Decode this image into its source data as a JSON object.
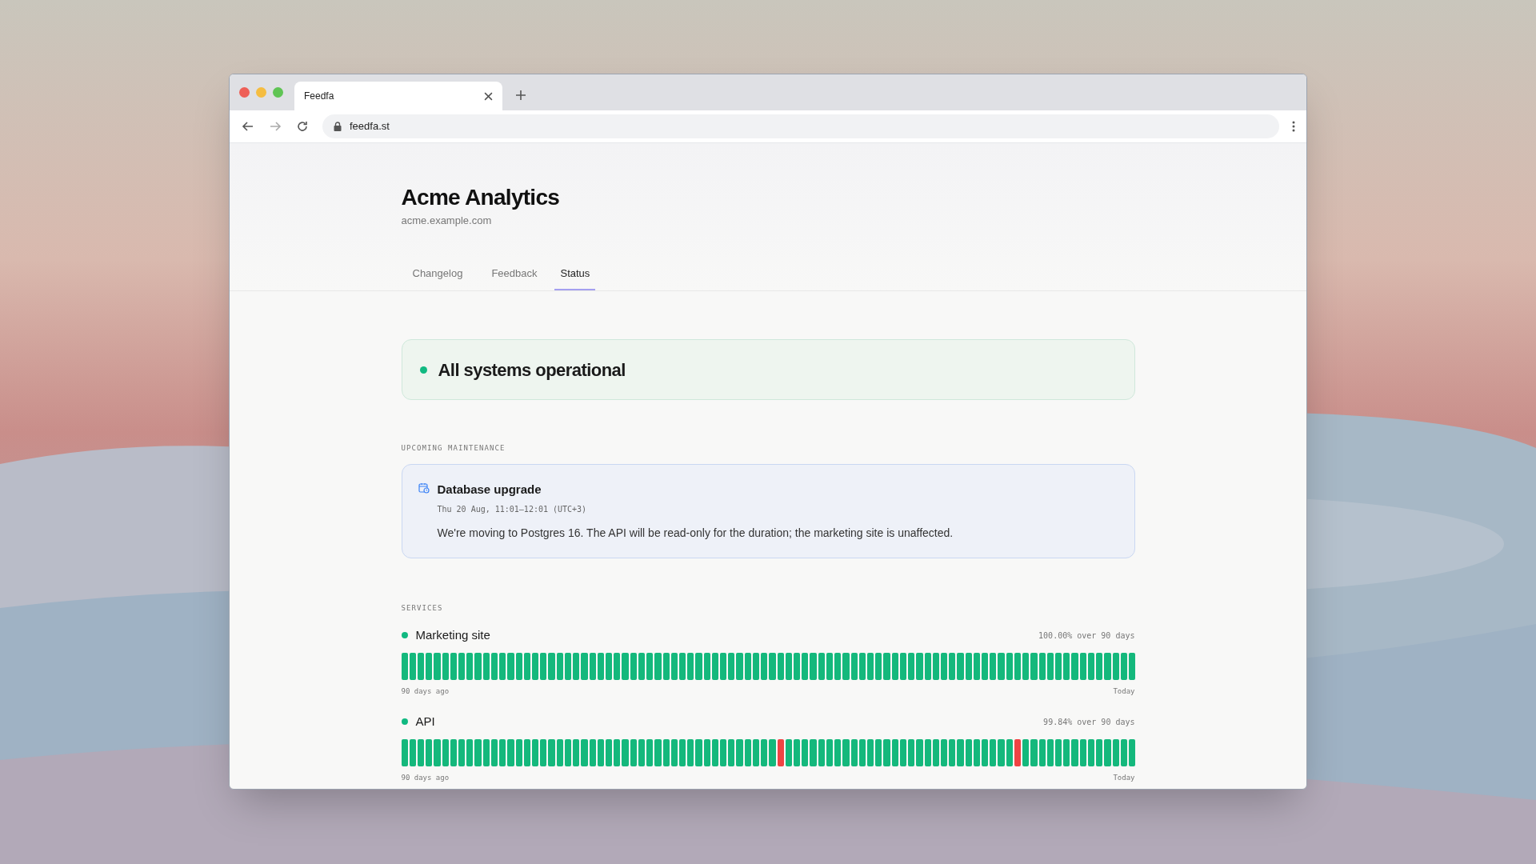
{
  "browser": {
    "tab_title": "Feedfa",
    "url": "feedfa.st"
  },
  "header": {
    "title": "Acme Analytics",
    "domain": "acme.example.com"
  },
  "tabs": [
    {
      "label": "Changelog",
      "selected": false
    },
    {
      "label": "Feedback",
      "selected": false
    },
    {
      "label": "Status",
      "selected": true
    }
  ],
  "overall": {
    "text": "All systems operational",
    "color": "#10b981"
  },
  "maintenance": {
    "heading": "UPCOMING MAINTENANCE",
    "title": "Database upgrade",
    "when": "Thu 20 Aug, 11:01–12:01 (UTC+3)",
    "body": "We're moving to Postgres 16. The API will be read-only for the duration; the marketing site is unaffected."
  },
  "services": {
    "heading": "SERVICES",
    "items": [
      {
        "name": "Marketing site",
        "color": "#10b981",
        "uptime": "100.00% over 90 days",
        "start_label": "90 days ago",
        "end_label": "Today",
        "days": [
          {
            "color": "#14b87c"
          },
          {
            "color": "#14b87c"
          },
          {
            "color": "#14b87c"
          },
          {
            "color": "#14b87c"
          },
          {
            "color": "#14b87c"
          },
          {
            "color": "#14b87c"
          },
          {
            "color": "#14b87c"
          },
          {
            "color": "#14b87c"
          },
          {
            "color": "#14b87c"
          },
          {
            "color": "#14b87c"
          },
          {
            "color": "#14b87c"
          },
          {
            "color": "#14b87c"
          },
          {
            "color": "#14b87c"
          },
          {
            "color": "#14b87c"
          },
          {
            "color": "#14b87c"
          },
          {
            "color": "#14b87c"
          },
          {
            "color": "#14b87c"
          },
          {
            "color": "#14b87c"
          },
          {
            "color": "#14b87c"
          },
          {
            "color": "#14b87c"
          },
          {
            "color": "#14b87c"
          },
          {
            "color": "#14b87c"
          },
          {
            "color": "#14b87c"
          },
          {
            "color": "#14b87c"
          },
          {
            "color": "#14b87c"
          },
          {
            "color": "#14b87c"
          },
          {
            "color": "#14b87c"
          },
          {
            "color": "#14b87c"
          },
          {
            "color": "#14b87c"
          },
          {
            "color": "#14b87c"
          },
          {
            "color": "#14b87c"
          },
          {
            "color": "#14b87c"
          },
          {
            "color": "#14b87c"
          },
          {
            "color": "#14b87c"
          },
          {
            "color": "#14b87c"
          },
          {
            "color": "#14b87c"
          },
          {
            "color": "#14b87c"
          },
          {
            "color": "#14b87c"
          },
          {
            "color": "#14b87c"
          },
          {
            "color": "#14b87c"
          },
          {
            "color": "#14b87c"
          },
          {
            "color": "#14b87c"
          },
          {
            "color": "#14b87c"
          },
          {
            "color": "#14b87c"
          },
          {
            "color": "#14b87c"
          },
          {
            "color": "#14b87c"
          },
          {
            "color": "#14b87c"
          },
          {
            "color": "#14b87c"
          },
          {
            "color": "#14b87c"
          },
          {
            "color": "#14b87c"
          },
          {
            "color": "#14b87c"
          },
          {
            "color": "#14b87c"
          },
          {
            "color": "#14b87c"
          },
          {
            "color": "#14b87c"
          },
          {
            "color": "#14b87c"
          },
          {
            "color": "#14b87c"
          },
          {
            "color": "#14b87c"
          },
          {
            "color": "#14b87c"
          },
          {
            "color": "#14b87c"
          },
          {
            "color": "#14b87c"
          },
          {
            "color": "#14b87c"
          },
          {
            "color": "#14b87c"
          },
          {
            "color": "#14b87c"
          },
          {
            "color": "#14b87c"
          },
          {
            "color": "#14b87c"
          },
          {
            "color": "#14b87c"
          },
          {
            "color": "#14b87c"
          },
          {
            "color": "#14b87c"
          },
          {
            "color": "#14b87c"
          },
          {
            "color": "#14b87c"
          },
          {
            "color": "#14b87c"
          },
          {
            "color": "#14b87c"
          },
          {
            "color": "#14b87c"
          },
          {
            "color": "#14b87c"
          },
          {
            "color": "#14b87c"
          },
          {
            "color": "#14b87c"
          },
          {
            "color": "#14b87c"
          },
          {
            "color": "#14b87c"
          },
          {
            "color": "#14b87c"
          },
          {
            "color": "#14b87c"
          },
          {
            "color": "#14b87c"
          },
          {
            "color": "#14b87c"
          },
          {
            "color": "#14b87c"
          },
          {
            "color": "#14b87c"
          },
          {
            "color": "#14b87c"
          },
          {
            "color": "#14b87c"
          },
          {
            "color": "#14b87c"
          },
          {
            "color": "#14b87c"
          },
          {
            "color": "#14b87c"
          },
          {
            "color": "#14b87c"
          }
        ]
      },
      {
        "name": "API",
        "color": "#10b981",
        "uptime": "99.84% over 90 days",
        "start_label": "90 days ago",
        "end_label": "Today",
        "days": [
          {
            "color": "#14b87c"
          },
          {
            "color": "#14b87c"
          },
          {
            "color": "#14b87c"
          },
          {
            "color": "#14b87c"
          },
          {
            "color": "#14b87c"
          },
          {
            "color": "#14b87c"
          },
          {
            "color": "#14b87c"
          },
          {
            "color": "#14b87c"
          },
          {
            "color": "#14b87c"
          },
          {
            "color": "#14b87c"
          },
          {
            "color": "#14b87c"
          },
          {
            "color": "#14b87c"
          },
          {
            "color": "#14b87c"
          },
          {
            "color": "#14b87c"
          },
          {
            "color": "#14b87c"
          },
          {
            "color": "#14b87c"
          },
          {
            "color": "#14b87c"
          },
          {
            "color": "#14b87c"
          },
          {
            "color": "#14b87c"
          },
          {
            "color": "#14b87c"
          },
          {
            "color": "#14b87c"
          },
          {
            "color": "#14b87c"
          },
          {
            "color": "#14b87c"
          },
          {
            "color": "#14b87c"
          },
          {
            "color": "#14b87c"
          },
          {
            "color": "#14b87c"
          },
          {
            "color": "#14b87c"
          },
          {
            "color": "#14b87c"
          },
          {
            "color": "#14b87c"
          },
          {
            "color": "#14b87c"
          },
          {
            "color": "#14b87c"
          },
          {
            "color": "#14b87c"
          },
          {
            "color": "#14b87c"
          },
          {
            "color": "#14b87c"
          },
          {
            "color": "#14b87c"
          },
          {
            "color": "#14b87c"
          },
          {
            "color": "#14b87c"
          },
          {
            "color": "#14b87c"
          },
          {
            "color": "#14b87c"
          },
          {
            "color": "#14b87c"
          },
          {
            "color": "#14b87c"
          },
          {
            "color": "#14b87c"
          },
          {
            "color": "#14b87c"
          },
          {
            "color": "#14b87c"
          },
          {
            "color": "#14b87c"
          },
          {
            "color": "#14b87c"
          },
          {
            "color": "#ef4444"
          },
          {
            "color": "#14b87c"
          },
          {
            "color": "#14b87c"
          },
          {
            "color": "#14b87c"
          },
          {
            "color": "#14b87c"
          },
          {
            "color": "#14b87c"
          },
          {
            "color": "#14b87c"
          },
          {
            "color": "#14b87c"
          },
          {
            "color": "#14b87c"
          },
          {
            "color": "#14b87c"
          },
          {
            "color": "#14b87c"
          },
          {
            "color": "#14b87c"
          },
          {
            "color": "#14b87c"
          },
          {
            "color": "#14b87c"
          },
          {
            "color": "#14b87c"
          },
          {
            "color": "#14b87c"
          },
          {
            "color": "#14b87c"
          },
          {
            "color": "#14b87c"
          },
          {
            "color": "#14b87c"
          },
          {
            "color": "#14b87c"
          },
          {
            "color": "#14b87c"
          },
          {
            "color": "#14b87c"
          },
          {
            "color": "#14b87c"
          },
          {
            "color": "#14b87c"
          },
          {
            "color": "#14b87c"
          },
          {
            "color": "#14b87c"
          },
          {
            "color": "#14b87c"
          },
          {
            "color": "#14b87c"
          },
          {
            "color": "#14b87c"
          },
          {
            "color": "#ef4444"
          },
          {
            "color": "#14b87c"
          },
          {
            "color": "#14b87c"
          },
          {
            "color": "#14b87c"
          },
          {
            "color": "#14b87c"
          },
          {
            "color": "#14b87c"
          },
          {
            "color": "#14b87c"
          },
          {
            "color": "#14b87c"
          },
          {
            "color": "#14b87c"
          },
          {
            "color": "#14b87c"
          },
          {
            "color": "#14b87c"
          },
          {
            "color": "#14b87c"
          },
          {
            "color": "#14b87c"
          },
          {
            "color": "#14b87c"
          },
          {
            "color": "#14b87c"
          }
        ]
      }
    ]
  }
}
